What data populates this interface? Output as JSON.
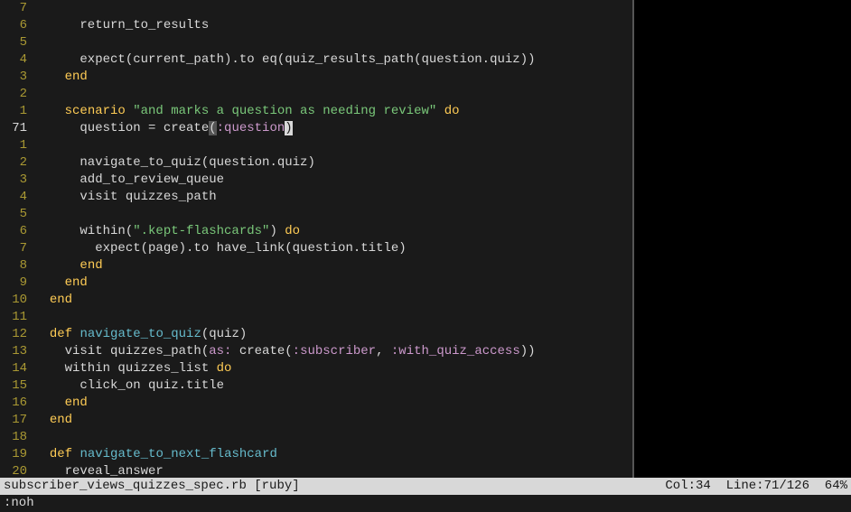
{
  "gutter": [
    "7",
    "6",
    "5",
    "4",
    "3",
    "2",
    "1",
    "71",
    "1",
    "2",
    "3",
    "4",
    "5",
    "6",
    "7",
    "8",
    "9",
    "10",
    "11",
    "12",
    "13",
    "14",
    "15",
    "16",
    "17",
    "18",
    "19",
    "20"
  ],
  "current_gutter_index": 7,
  "code": {
    "l0": "",
    "l1": "      return_to_results",
    "l2": "",
    "l3a": "      expect(current_path).to eq(quiz_results_path(question.quiz))",
    "l4": "    ",
    "l4end": "end",
    "l5": "",
    "l6a": "    ",
    "l6kw": "scenario",
    "l6str": " \"and marks a question as needing review\"",
    "l6do": " do",
    "l7a": "      question = create",
    "l7lp": "(",
    "l7sym": ":question",
    "l7rp": ")",
    "l8": "",
    "l9": "      navigate_to_quiz(question.quiz)",
    "l10": "      add_to_review_queue",
    "l11": "      visit quizzes_path",
    "l12": "",
    "l13a": "      within(",
    "l13str": "\".kept-flashcards\"",
    "l13b": ") ",
    "l13do": "do",
    "l14": "        expect(page).to have_link(question.title)",
    "l15a": "      ",
    "l15end": "end",
    "l16a": "    ",
    "l16end": "end",
    "l17a": "  ",
    "l17end": "end",
    "l18": "",
    "l19a": "  ",
    "l19def": "def",
    "l19sp": " ",
    "l19name": "navigate_to_quiz",
    "l19rest": "(quiz)",
    "l20a": "    visit quizzes_path(",
    "l20as": "as:",
    "l20b": " create(",
    "l20s1": ":subscriber",
    "l20c": ", ",
    "l20s2": ":with_quiz_access",
    "l20d": "))",
    "l21a": "    within quizzes_list ",
    "l21do": "do",
    "l22": "      click_on quiz.title",
    "l23a": "    ",
    "l23end": "end",
    "l24a": "  ",
    "l24end": "end",
    "l25": "",
    "l26a": "  ",
    "l26def": "def",
    "l26sp": " ",
    "l26name": "navigate_to_next_flashcard",
    "l27": "    reveal_answer"
  },
  "status": {
    "file": "subscriber_views_quizzes_spec.rb [ruby]",
    "right": "Col:34  Line:71/126  64%"
  },
  "cmdline": ":noh"
}
